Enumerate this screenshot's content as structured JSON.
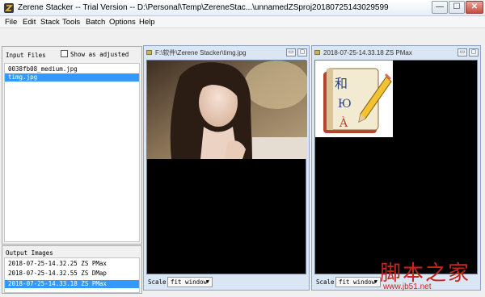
{
  "window": {
    "title": "Zerene Stacker -- Trial Version -- D:\\Personal\\Temp\\ZereneStac...\\unnamedZSproj20180725143029599",
    "minimize": "—",
    "maximize": "☐",
    "close": "✕"
  },
  "menu": [
    "File",
    "Edit",
    "Stack",
    "Tools",
    "Batch",
    "Options",
    "Help"
  ],
  "input_files": {
    "label": "Input Files",
    "show_adjusted_label": "Show as adjusted",
    "show_adjusted_checked": false,
    "items": [
      {
        "name": "0038fb08_medium.jpg",
        "selected": false
      },
      {
        "name": "timg.jpg",
        "selected": true
      }
    ]
  },
  "output_images": {
    "label": "Output Images",
    "items": [
      {
        "name": "2018-07-25-14.32.25 ZS PMax",
        "selected": false
      },
      {
        "name": "2018-07-25-14.32.55 ZS DMap",
        "selected": false
      },
      {
        "name": "2018-07-25-14.33.18 ZS PMax",
        "selected": true
      }
    ]
  },
  "viewer_left": {
    "title": "F:\\软件\\Zerene Stacker\\timg.jpg",
    "scale_label": "Scale",
    "scale_value": "fit window"
  },
  "viewer_right": {
    "title": "2018-07-25-14.33.18 ZS PMax",
    "scale_label": "Scale",
    "scale_value": "fit window"
  },
  "watermark": {
    "title": "脚本之家",
    "url": "www.jb51.net"
  },
  "colors": {
    "selection": "#3399ff",
    "canvas": "#000000",
    "watermark": "#c7251c"
  }
}
